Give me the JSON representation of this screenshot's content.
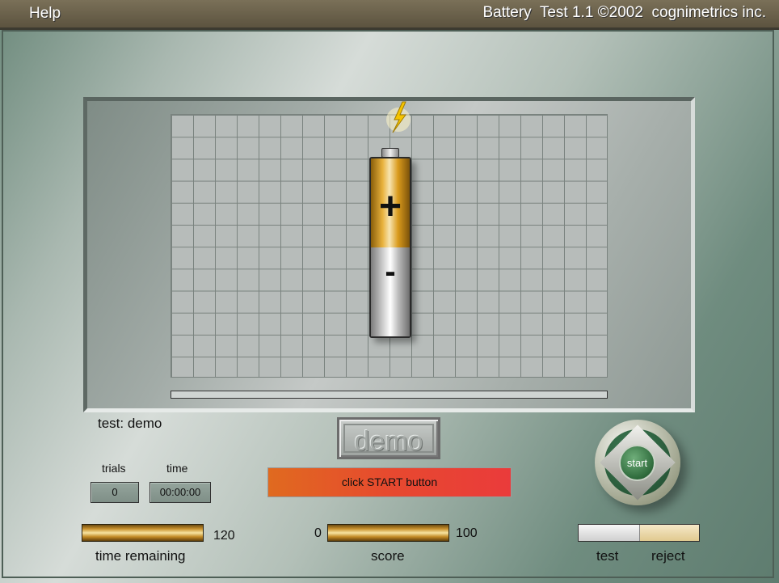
{
  "header": {
    "help_label": "Help",
    "app_title": "Battery  Test 1.1 ©2002  cognimetrics inc."
  },
  "test": {
    "label": "test: demo"
  },
  "mode_badge": "demo",
  "trials": {
    "label": "trials",
    "value": "0"
  },
  "time": {
    "label": "time",
    "value": "00:00:00"
  },
  "status_message": "click START button",
  "status_color": "#e7492f",
  "time_remaining": {
    "label": "time remaining",
    "max": "120"
  },
  "score": {
    "label": "score",
    "min": "0",
    "max": "100"
  },
  "start_button": {
    "label": "start"
  },
  "decision": {
    "test_label": "test",
    "reject_label": "reject"
  },
  "icons": [
    "spark-icon",
    "battery-icon"
  ]
}
